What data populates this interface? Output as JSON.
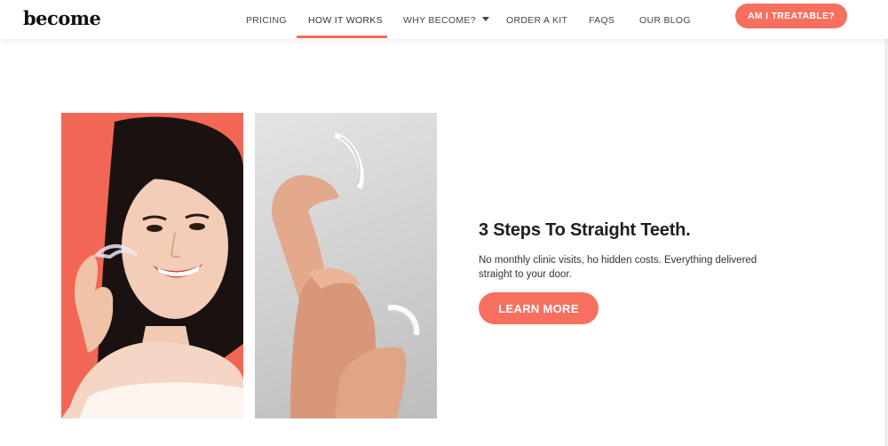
{
  "header": {
    "logo": "become",
    "nav": [
      {
        "label": "PRICING"
      },
      {
        "label": "HOW IT WORKS"
      },
      {
        "label": "WHY BECOME?"
      },
      {
        "label": "ORDER A KIT"
      },
      {
        "label": "FAQS"
      },
      {
        "label": "OUR BLOG"
      }
    ],
    "active_nav": "HOW IT WORKS",
    "cta_label": "AM I TREATABLE?"
  },
  "hero": {
    "headline": "3 Steps To Straight Teeth.",
    "description": "No monthly clinic visits, ho hidden costs. Everything delivered straight to your door.",
    "button_label": "LEARN MORE"
  },
  "images": [
    {
      "subject": "woman smiling holding clear aligner",
      "background": "#f26656"
    },
    {
      "subject": "hands holding clear aligners",
      "background": "#d6d6d6"
    }
  ],
  "colors": {
    "accent": "#f7705f",
    "text_dark": "#1e1e1e",
    "nav_text": "#444444"
  }
}
